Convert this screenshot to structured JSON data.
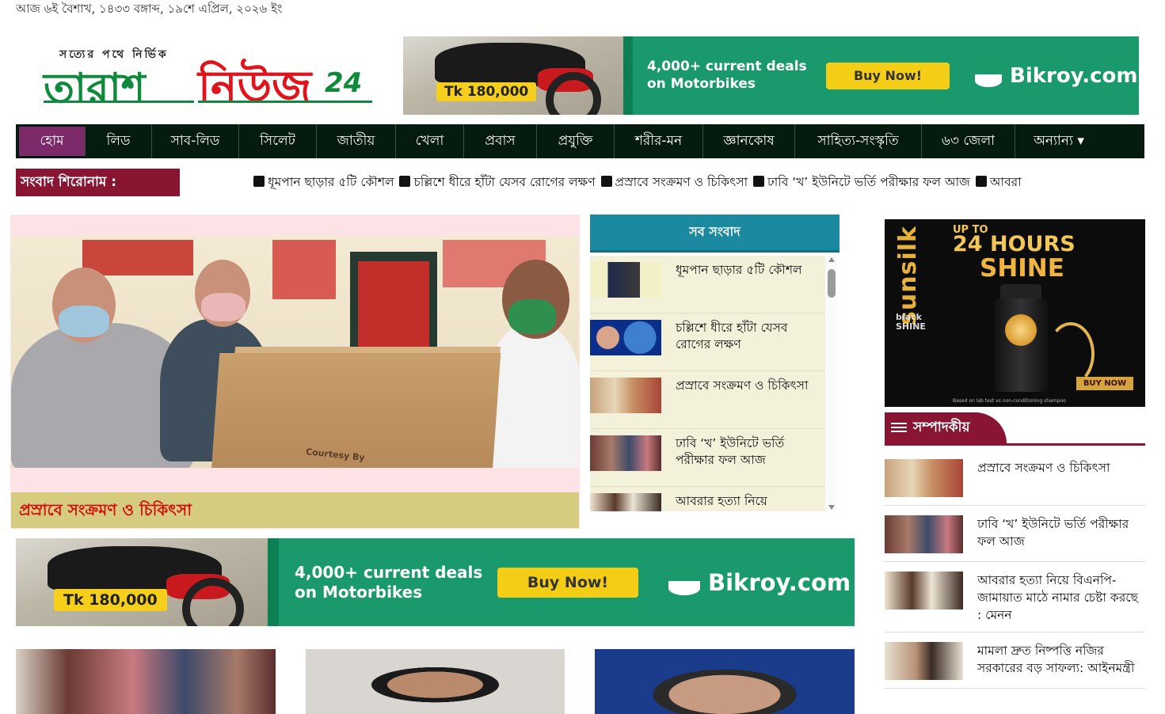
{
  "date_line": "আজ ৬ই বৈশাখ, ১৪৩৩ বঙ্গাব্দ, ১৯শে এপ্রিল, ২০২৬ ইং",
  "logo": {
    "tagline": "সত্যের পথে নির্ভিক",
    "word1": "তারাশ",
    "word2": "নিউজ",
    "number": "24"
  },
  "ad_banner": {
    "price": "Tk 180,000",
    "deal_line1": "4,000+ current deals",
    "deal_line2": "on Motorbikes",
    "button": "Buy Now!",
    "brand": "Bikroy.com"
  },
  "nav": {
    "items": [
      "হোম",
      "লিড",
      "সাব-লিড",
      "সিলেট",
      "জাতীয়",
      "খেলা",
      "প্রবাস",
      "প্রযুক্তি",
      "শরীর-মন",
      "জ্ঞানকোষ",
      "সাহিত্য-সংস্কৃতি",
      "৬৩ জেলা",
      "অন্যান্য ▾"
    ],
    "active_index": 0
  },
  "ticker": {
    "label": "সংবাদ শিরোনাম :",
    "items": [
      "ধূমপান ছাড়ার ৫টি কৌশল",
      "চল্লিশে ধীরে হাঁটা যেসব রোগের লক্ষণ",
      "প্রস্রাবে সংক্রমণ ও চিকিৎসা",
      "ঢাবি ‘খ’ ইউনিটে ভর্তি পরীক্ষার ফল আজ",
      "আবরা"
    ]
  },
  "lead": {
    "photo_text": "Courtesy By",
    "caption": "প্রস্রাবে সংক্রমণ ও চিকিৎসা"
  },
  "all_news": {
    "header": "সব সংবাদ",
    "items": [
      {
        "title": "ধূমপান ছাড়ার ৫টি কৌশল"
      },
      {
        "title": "চল্লিশে ধীরে হাঁটা যেসব রোগের লক্ষণ"
      },
      {
        "title": "প্রস্রাবে সংক্রমণ ও চিকিৎসা"
      },
      {
        "title": "ঢাবি ‘খ’ ইউনিটে ভর্তি পরীক্ষার ফল আজ"
      },
      {
        "title": "আবরার হত্যা নিয়ে"
      }
    ]
  },
  "sunsilk_ad": {
    "brand": "sunsilk",
    "sub": "black SHINE",
    "up_to": "UP TO",
    "hours": "24 HOURS",
    "shine": "SHINE",
    "button": "BUY NOW",
    "fine": "Based on lab test vs non-conditioning shampoo"
  },
  "editorial": {
    "header": "সম্পাদকীয়",
    "items": [
      {
        "title": "প্রস্রাবে সংক্রমণ ও চিকিৎসা"
      },
      {
        "title": "ঢাবি ‘খ’ ইউনিটে ভর্তি পরীক্ষার ফল আজ"
      },
      {
        "title": "আবরার হত্যা নিয়ে বিএনপি-জামায়াত মাঠে নামার চেষ্টা করছে : মেনন"
      },
      {
        "title": "মামলা দ্রুত নিষ্পত্তি নজির সরকারের বড় সাফল্য: আইনমন্ত্রী"
      }
    ]
  },
  "colors": {
    "nav_bg": "#051b0f",
    "nav_active": "#7c2a6a",
    "ticker_label_bg": "#8a1533",
    "all_news_header": "#1b8aa0",
    "ad_green": "#1a9a6c",
    "buy_button": "#f4cd16"
  }
}
